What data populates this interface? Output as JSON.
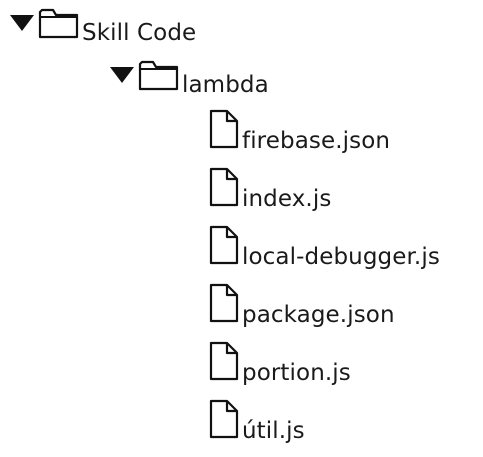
{
  "tree": {
    "root": {
      "label": "Skill Code",
      "expanded": true,
      "icon": "folder-icon",
      "children_folder": {
        "label": "lambda",
        "expanded": true,
        "icon": "folder-icon",
        "files": [
          {
            "label": "firebase.json",
            "icon": "file-icon"
          },
          {
            "label": "index.js",
            "icon": "file-icon"
          },
          {
            "label": "local-debugger.js",
            "icon": "file-icon"
          },
          {
            "label": "package.json",
            "icon": "file-icon"
          },
          {
            "label": "portion.js",
            "icon": "file-icon"
          },
          {
            "label": "útil.js",
            "icon": "file-icon"
          }
        ]
      }
    }
  }
}
